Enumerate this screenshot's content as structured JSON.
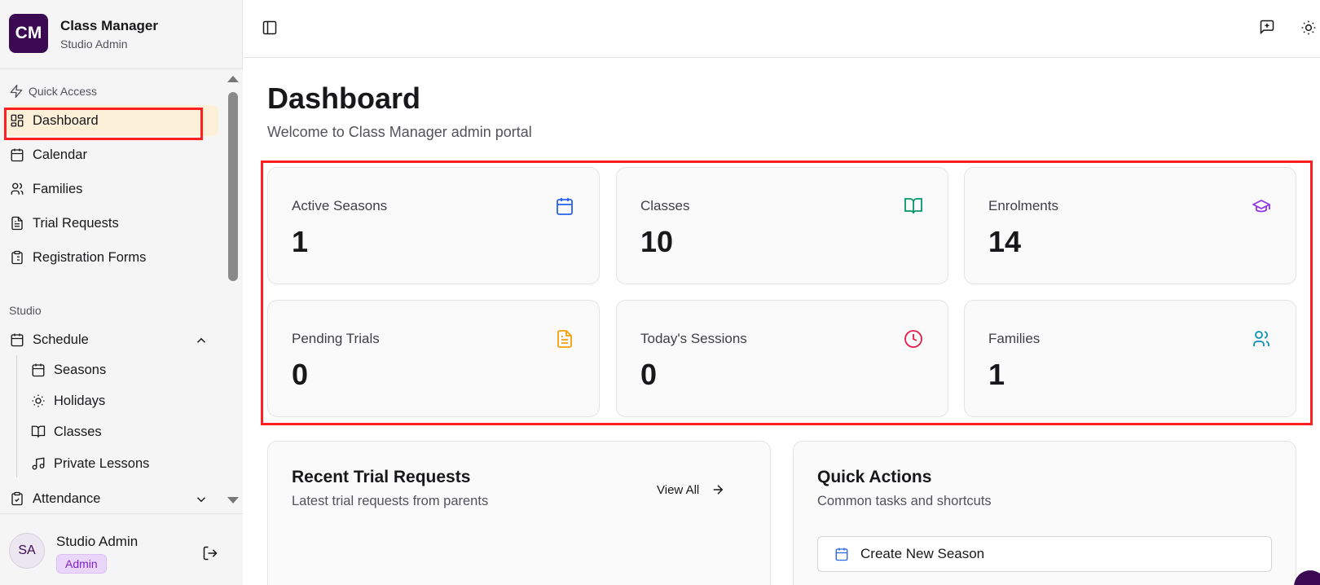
{
  "brand": {
    "logo": "CM",
    "name": "Class Manager",
    "subtitle": "Studio Admin"
  },
  "sidebar": {
    "quick_access_label": "Quick Access",
    "quick_items": [
      {
        "label": "Dashboard",
        "icon": "layout-dashboard-icon",
        "active": true
      },
      {
        "label": "Calendar",
        "icon": "calendar-icon"
      },
      {
        "label": "Families",
        "icon": "users-icon"
      },
      {
        "label": "Trial Requests",
        "icon": "file-text-icon"
      },
      {
        "label": "Registration Forms",
        "icon": "clipboard-list-icon"
      }
    ],
    "studio_label": "Studio",
    "schedule": {
      "label": "Schedule",
      "expanded": true,
      "children": [
        {
          "label": "Seasons",
          "icon": "calendar-icon"
        },
        {
          "label": "Holidays",
          "icon": "sun-icon"
        },
        {
          "label": "Classes",
          "icon": "book-open-icon"
        },
        {
          "label": "Private Lessons",
          "icon": "music-icon"
        }
      ]
    },
    "attendance": {
      "label": "Attendance",
      "expanded": false
    }
  },
  "user": {
    "initials": "SA",
    "name": "Studio Admin",
    "role": "Admin"
  },
  "header": {
    "title": "Dashboard",
    "subtitle": "Welcome to Class Manager admin portal"
  },
  "stats": [
    {
      "label": "Active Seasons",
      "value": "1",
      "icon": "calendar-icon",
      "color": "#2563eb"
    },
    {
      "label": "Classes",
      "value": "10",
      "icon": "book-open-icon",
      "color": "#059669"
    },
    {
      "label": "Enrolments",
      "value": "14",
      "icon": "graduation-cap-icon",
      "color": "#9333ea"
    },
    {
      "label": "Pending Trials",
      "value": "0",
      "icon": "file-text-icon",
      "color": "#f59e0b"
    },
    {
      "label": "Today's Sessions",
      "value": "0",
      "icon": "clock-icon",
      "color": "#e11d48"
    },
    {
      "label": "Families",
      "value": "1",
      "icon": "users-icon",
      "color": "#0891b2"
    }
  ],
  "recent_trials": {
    "title": "Recent Trial Requests",
    "subtitle": "Latest trial requests from parents",
    "view_all": "View All"
  },
  "quick_actions": {
    "title": "Quick Actions",
    "subtitle": "Common tasks and shortcuts",
    "actions": [
      {
        "label": "Create New Season",
        "icon": "calendar-icon"
      }
    ]
  },
  "colors": {
    "brand": "#3b0a52",
    "active_bg": "#fdf0d8",
    "highlight_box": "#ff1f1f"
  }
}
